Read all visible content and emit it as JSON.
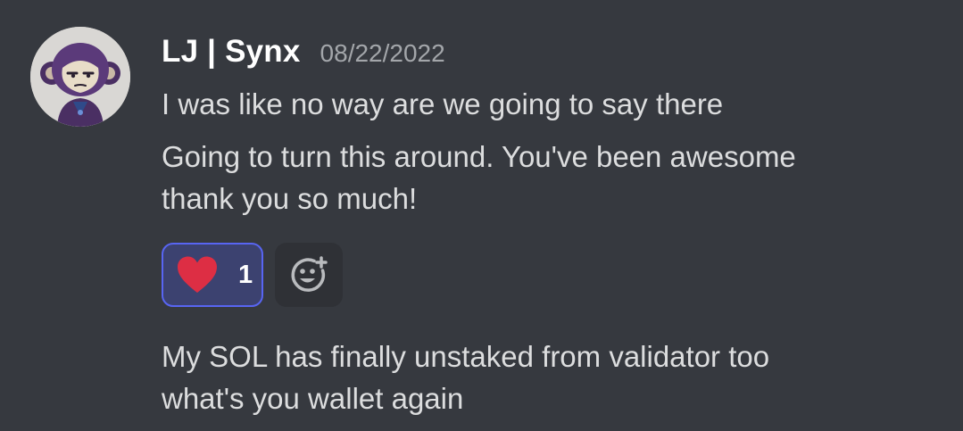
{
  "user": {
    "name": "LJ | Synx",
    "timestamp": "08/22/2022"
  },
  "messages": [
    {
      "lines": [
        "I was like no way are we going to say there"
      ]
    },
    {
      "lines": [
        "Going to turn this around. You've been awesome",
        "thank you so much!"
      ]
    },
    {
      "lines": [
        "My SOL has finally unstaked from validator too",
        "what's you wallet again"
      ]
    }
  ],
  "reactions": [
    {
      "emoji": "heart-icon",
      "count": "1",
      "color": "#dd2e44"
    }
  ],
  "add_reaction_icon": "add-reaction-icon",
  "colors": {
    "background": "#36393f",
    "reaction_bg": "#3c4270",
    "reaction_border": "#5865f2",
    "text": "#dcddde",
    "muted": "#a3a6aa"
  }
}
